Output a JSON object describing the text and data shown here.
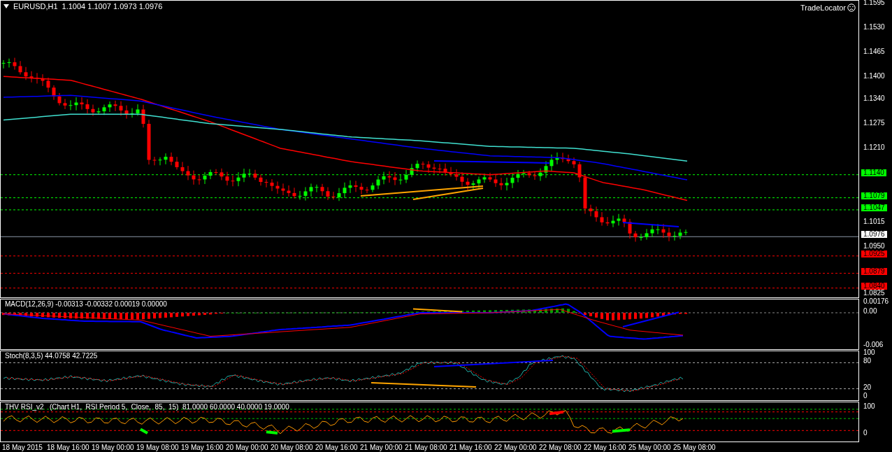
{
  "chart_header": {
    "symbol": "EURUSD,H1",
    "ohlc": "1.1004 1.1007 1.0973 1.0976"
  },
  "trade_locator": {
    "label": "TradeLocator"
  },
  "price_axis": {
    "ticks": [
      "1.1595",
      "1.1530",
      "1.1465",
      "1.1400",
      "1.1340",
      "1.1275",
      "1.1210",
      "1.1015",
      "1.0950",
      "1.0825"
    ]
  },
  "price_levels": [
    {
      "price": "1.1140",
      "kind": "level",
      "color": "#00ff00"
    },
    {
      "price": "1.1079",
      "kind": "level",
      "color": "#00ff00"
    },
    {
      "price": "1.1047",
      "kind": "level",
      "color": "#00ff00"
    },
    {
      "price": "1.0976",
      "kind": "bid",
      "color": "#ffffff"
    },
    {
      "price": "1.0925",
      "kind": "level",
      "color": "#ff0000"
    },
    {
      "price": "1.0879",
      "kind": "level",
      "color": "#ff0000"
    },
    {
      "price": "1.0840",
      "kind": "level",
      "color": "#ff0000"
    }
  ],
  "macd": {
    "label": "MACD(12,26,9) -0.00313 -0.00332 0.00019 0.00000",
    "ticks": [
      "0.00176",
      "0.00",
      "-0.006"
    ]
  },
  "stochastic": {
    "label": "Stoch(8,3,5) 44.0758 42.7225",
    "ticks": [
      "100",
      "80",
      "20",
      "0"
    ]
  },
  "rsi": {
    "label": "THV RSI_v2   (Chart H1,  RSI Period 5,  Close,  85,  15)  81.0000 60.0000 40.0000 19.0000",
    "ticks": [
      "100",
      "0"
    ]
  },
  "time_axis": {
    "labels": [
      "18 May 2015",
      "18 May 16:00",
      "19 May 00:00",
      "19 May 08:00",
      "19 May 16:00",
      "20 May 00:00",
      "20 May 08:00",
      "20 May 16:00",
      "21 May 00:00",
      "21 May 08:00",
      "21 May 16:00",
      "22 May 00:00",
      "22 May 08:00",
      "22 May 16:00",
      "25 May 00:00",
      "25 May 08:00"
    ]
  }
}
